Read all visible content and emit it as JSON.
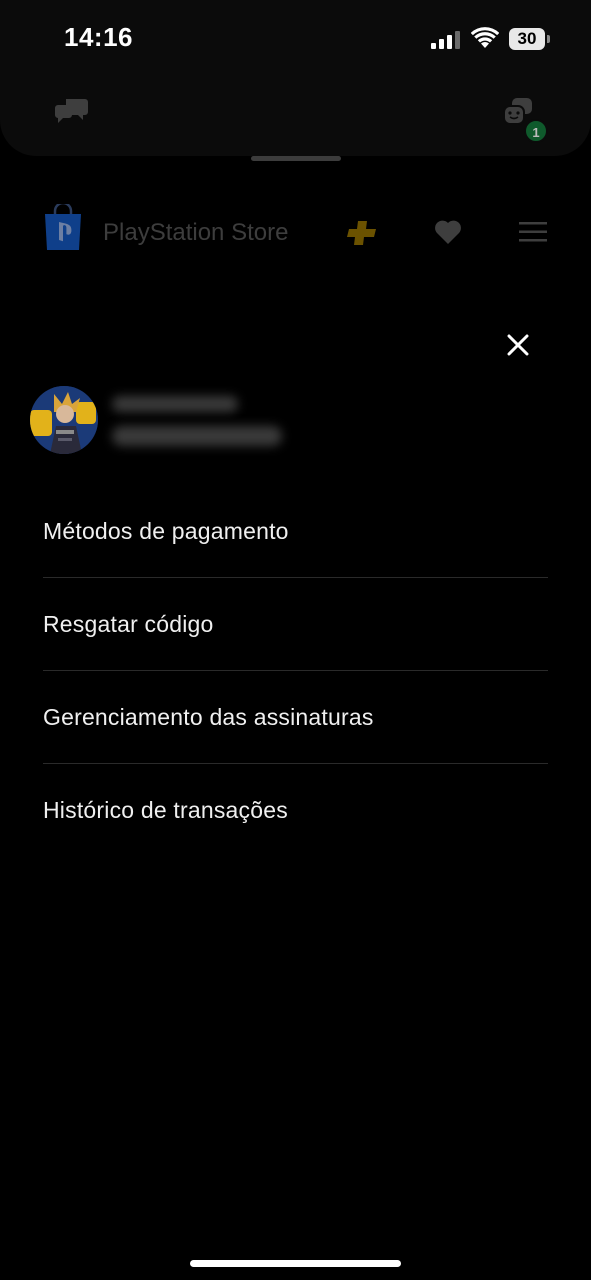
{
  "status_bar": {
    "time": "14:16",
    "battery": "30"
  },
  "top_panel": {
    "party_badge": "1"
  },
  "store": {
    "title": "PlayStation Store"
  },
  "menu": {
    "items": [
      "Métodos de pagamento",
      "Resgatar código",
      "Gerenciamento das assinaturas",
      "Histórico de transações"
    ]
  },
  "colors": {
    "background": "#000000",
    "panel": "#0b0b0b",
    "divider": "#2a2a2a",
    "plus_gold": "#6b5200",
    "ps_blue": "#0f3f8a",
    "badge_green": "#0f5a2c"
  },
  "icons": [
    "signal-icon",
    "wifi-icon",
    "battery-icon",
    "chat-icon",
    "party-icon",
    "playstation-bag-icon",
    "ps-plus-icon",
    "heart-icon",
    "hamburger-menu-icon",
    "close-icon"
  ]
}
